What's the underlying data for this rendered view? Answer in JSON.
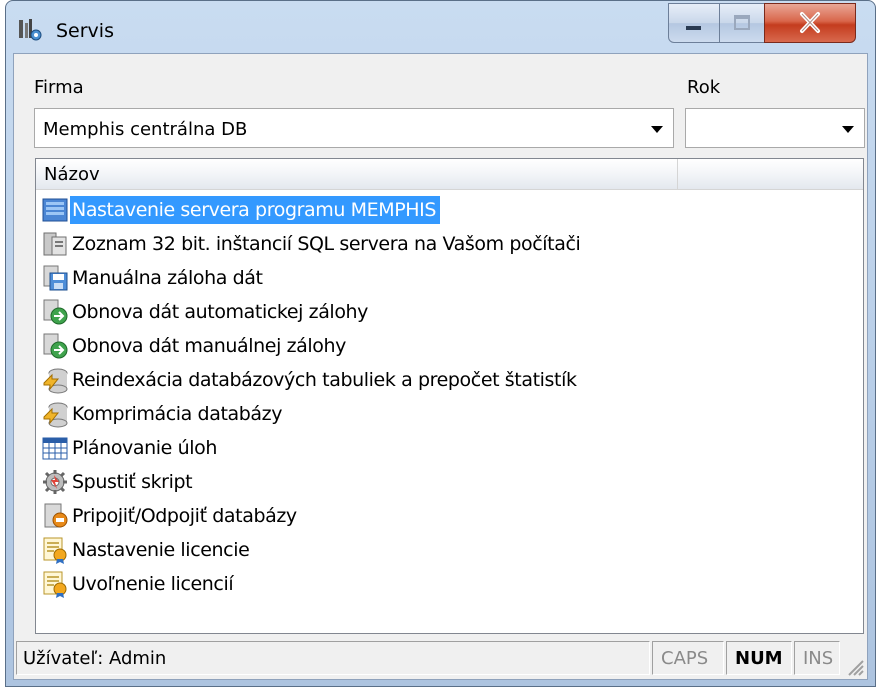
{
  "window": {
    "title": "Servis",
    "icon": "tools-app-icon",
    "controls": [
      "minimize-icon",
      "maximize-icon",
      "close-icon"
    ]
  },
  "firma": {
    "label": "Firma",
    "value": "Memphis centrálna DB"
  },
  "rok": {
    "label": "Rok",
    "value": ""
  },
  "list": {
    "columns": [
      "Názov",
      ""
    ],
    "items": [
      {
        "label": "Nastavenie servera programu MEMPHIS",
        "icon": "server-settings-icon",
        "selected": true
      },
      {
        "label": "Zoznam 32 bit. inštancií SQL servera na Vašom počítači",
        "icon": "server-list-icon",
        "selected": false
      },
      {
        "label": "Manuálna záloha dát",
        "icon": "save-backup-icon",
        "selected": false
      },
      {
        "label": "Obnova dát automatickej zálohy",
        "icon": "restore-icon",
        "selected": false
      },
      {
        "label": "Obnova dát manuálnej zálohy",
        "icon": "restore-icon",
        "selected": false
      },
      {
        "label": "Reindexácia databázových tabuliek a prepočet štatistík",
        "icon": "database-reindex-icon",
        "selected": false
      },
      {
        "label": "Komprimácia databázy",
        "icon": "database-compress-icon",
        "selected": false
      },
      {
        "label": "Plánovanie úloh",
        "icon": "calendar-icon",
        "selected": false
      },
      {
        "label": "Spustiť skript",
        "icon": "gear-script-icon",
        "selected": false
      },
      {
        "label": "Pripojiť/Odpojiť databázy",
        "icon": "database-attach-icon",
        "selected": false
      },
      {
        "label": "Nastavenie licencie",
        "icon": "license-icon",
        "selected": false
      },
      {
        "label": "Uvoľnenie licencií",
        "icon": "license-icon",
        "selected": false
      }
    ]
  },
  "status": {
    "user": "Užívateľ: Admin",
    "caps": "CAPS",
    "num": "NUM",
    "ins": "INS"
  }
}
